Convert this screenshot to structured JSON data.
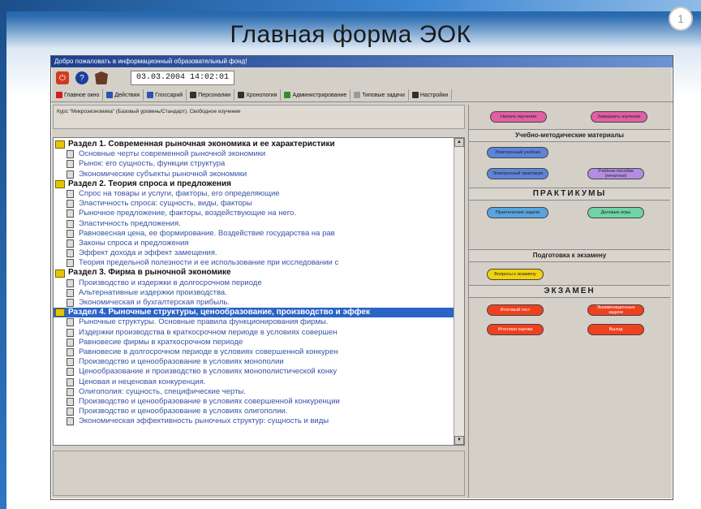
{
  "slide": {
    "title": "Главная форма ЭОК",
    "corner_mark": "1"
  },
  "window": {
    "title": "Добро пожаловать в информационный образовательный фонд!",
    "datetime": "03.03.2004 14:02:01"
  },
  "tabs": [
    {
      "label": "Главное окно",
      "icon_color": "#d02020"
    },
    {
      "label": "Действия",
      "icon_color": "#2a54b0"
    },
    {
      "label": "Глоссарий",
      "icon_color": "#2a54b0"
    },
    {
      "label": "Персоналии",
      "icon_color": "#303030"
    },
    {
      "label": "Хронология",
      "icon_color": "#303030"
    },
    {
      "label": "Администрирование",
      "icon_color": "#2f8f2f"
    },
    {
      "label": "Типовые задачи",
      "icon_color": "#9a9a9a"
    },
    {
      "label": "Настройки",
      "icon_color": "#303030"
    }
  ],
  "course_header": "Курс \"Микроэкономика\" (Базовый уровень/Стандарт). Свободное изучение",
  "tree": [
    {
      "type": "section",
      "text": "Раздел 1. Современная рыночная экономика и ее характеристики"
    },
    {
      "type": "topic",
      "text": "Основные черты современной рыночной экономики"
    },
    {
      "type": "topic",
      "text": "Рынок: его сущность, функции структура"
    },
    {
      "type": "topic",
      "text": "Экономические субъекты рыночной экономики"
    },
    {
      "type": "section",
      "text": "Раздел 2. Теория спроса и предложения"
    },
    {
      "type": "topic",
      "text": "Спрос на товары и услуги, факторы, его определяющие"
    },
    {
      "type": "topic",
      "text": "Эластичность спроса: сущность, виды, факторы"
    },
    {
      "type": "topic",
      "text": "Рыночное предложение, факторы, воздействующие на него."
    },
    {
      "type": "topic",
      "text": "Эластичность предложения."
    },
    {
      "type": "topic",
      "text": "Равновесная цена, ее формирование. Воздействие государства на рав"
    },
    {
      "type": "topic",
      "text": "Законы спроса и предложения"
    },
    {
      "type": "topic",
      "text": "Эффект дохода и эффект замещения."
    },
    {
      "type": "topic",
      "text": "Теория предельной полезности и ее использование при исследовании с"
    },
    {
      "type": "section",
      "text": "Раздел 3. Фирма в рыночной экономике"
    },
    {
      "type": "topic",
      "text": "Производство и издержки в долгосрочном периоде"
    },
    {
      "type": "topic",
      "text": "Альтернативные издержки производства."
    },
    {
      "type": "topic",
      "text": "Экономическая и бухгалтерская прибыль."
    },
    {
      "type": "section",
      "text": "Раздел 4. Рыночные структуры, ценообразование, производство и эффек",
      "selected": true
    },
    {
      "type": "topic",
      "text": "Рыночные структуры. Основные правила функционирования фирмы."
    },
    {
      "type": "topic",
      "text": "Издержки производства в краткосрочном периоде в условиях совершен"
    },
    {
      "type": "topic",
      "text": "Равновесие фирмы в краткосрочном периоде"
    },
    {
      "type": "topic",
      "text": "Равновесие в долгосрочном периоде в условиях совершенной конкурен"
    },
    {
      "type": "topic",
      "text": "Производство и ценообразование в условиях монополии"
    },
    {
      "type": "topic",
      "text": "Ценообразование и производство в условиях монополистической конку"
    },
    {
      "type": "topic",
      "text": "Ценовая и неценовая конкуренция."
    },
    {
      "type": "topic",
      "text": "Олигополия: сущность, специфические черты."
    },
    {
      "type": "topic",
      "text": "Производство и ценообразование в условиях совершенной конкуренции"
    },
    {
      "type": "topic",
      "text": "Производство и ценообразование в условиях олигополии."
    },
    {
      "type": "topic",
      "text": "Экономическая эффективность рыночных структур: сущность и виды"
    }
  ],
  "right_panel": {
    "top_buttons": [
      "Начало изучения",
      "Завершить изучение"
    ],
    "materials_heading": "Учебно-методические материалы",
    "materials_buttons": [
      "Электронный учебник",
      "Электронный практикум",
      "Учебное пособие (печатное)"
    ],
    "practice_heading": "ПРАКТИКУМЫ",
    "practice_buttons": [
      "Практические задачи",
      "Деловые игры"
    ],
    "exam_prep_heading": "Подготовка к экзамену",
    "exam_prep_buttons": [
      "Вопросы к экзамену"
    ],
    "exam_heading": "ЭКЗАМЕН",
    "exam_buttons": [
      "Итоговый тест",
      "Экзаменационные задачи",
      "Итоговая оценка",
      "Выход"
    ]
  },
  "colors": {
    "pink": "#e05fa5",
    "blue": "#5c84d9",
    "lilac": "#b48de2",
    "green": "#6fd3a3",
    "yellow": "#f2d20b",
    "red": "#ef4020",
    "selection": "#2a64c7"
  }
}
